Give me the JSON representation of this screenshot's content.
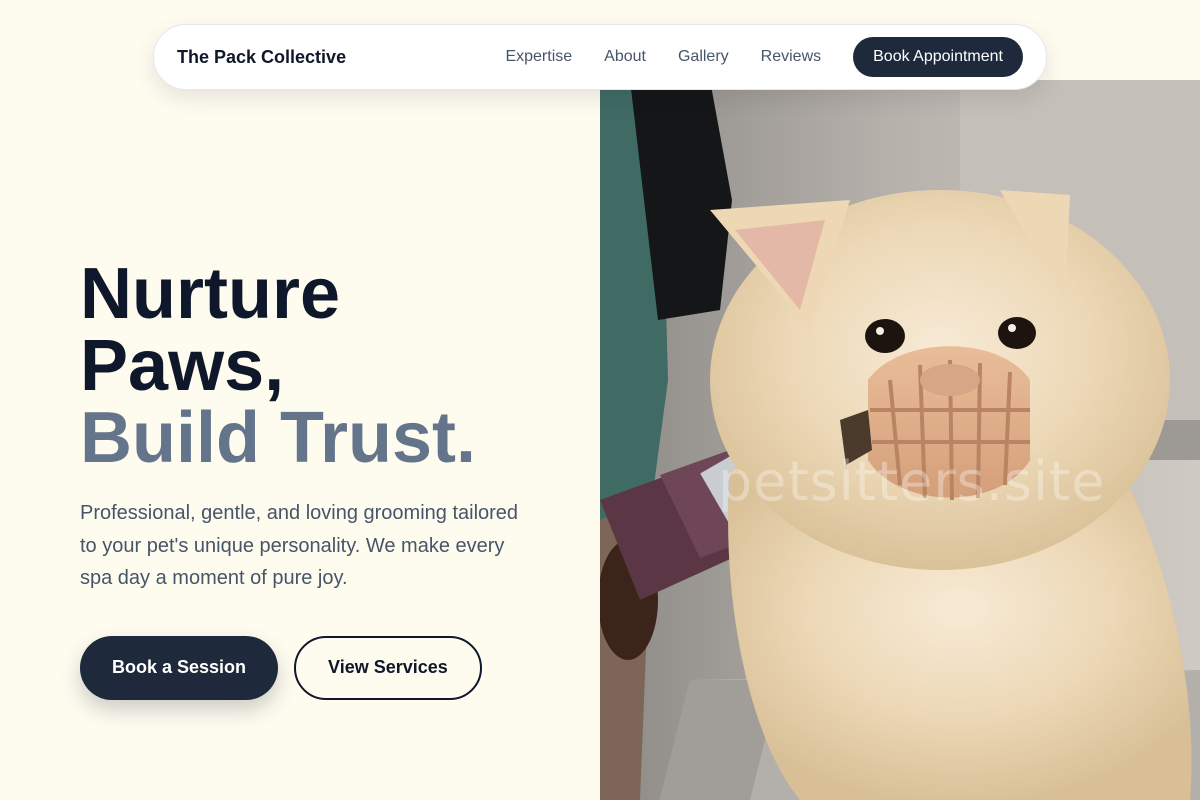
{
  "nav": {
    "brand": "The Pack Collective",
    "links": [
      "Expertise",
      "About",
      "Gallery",
      "Reviews"
    ],
    "cta_label": "Book Appointment"
  },
  "hero": {
    "headline_line1": "Nurture",
    "headline_line2": "Paws,",
    "headline_accent": "Build Trust.",
    "subtitle": "Professional, gentle, and loving grooming tailored to your pet's unique personality. We make every spa day a moment of pure joy.",
    "primary_button": "Book a Session",
    "secondary_button": "View Services",
    "image_watermark": "petsitters.site"
  },
  "colors": {
    "page_background": "#fefcef",
    "primary_dark": "#1e293b",
    "heading": "#0f172a",
    "accent_text": "#64748b",
    "body_text": "#475569"
  },
  "icons": {
    "hero_image": "dog-grooming-photo"
  }
}
